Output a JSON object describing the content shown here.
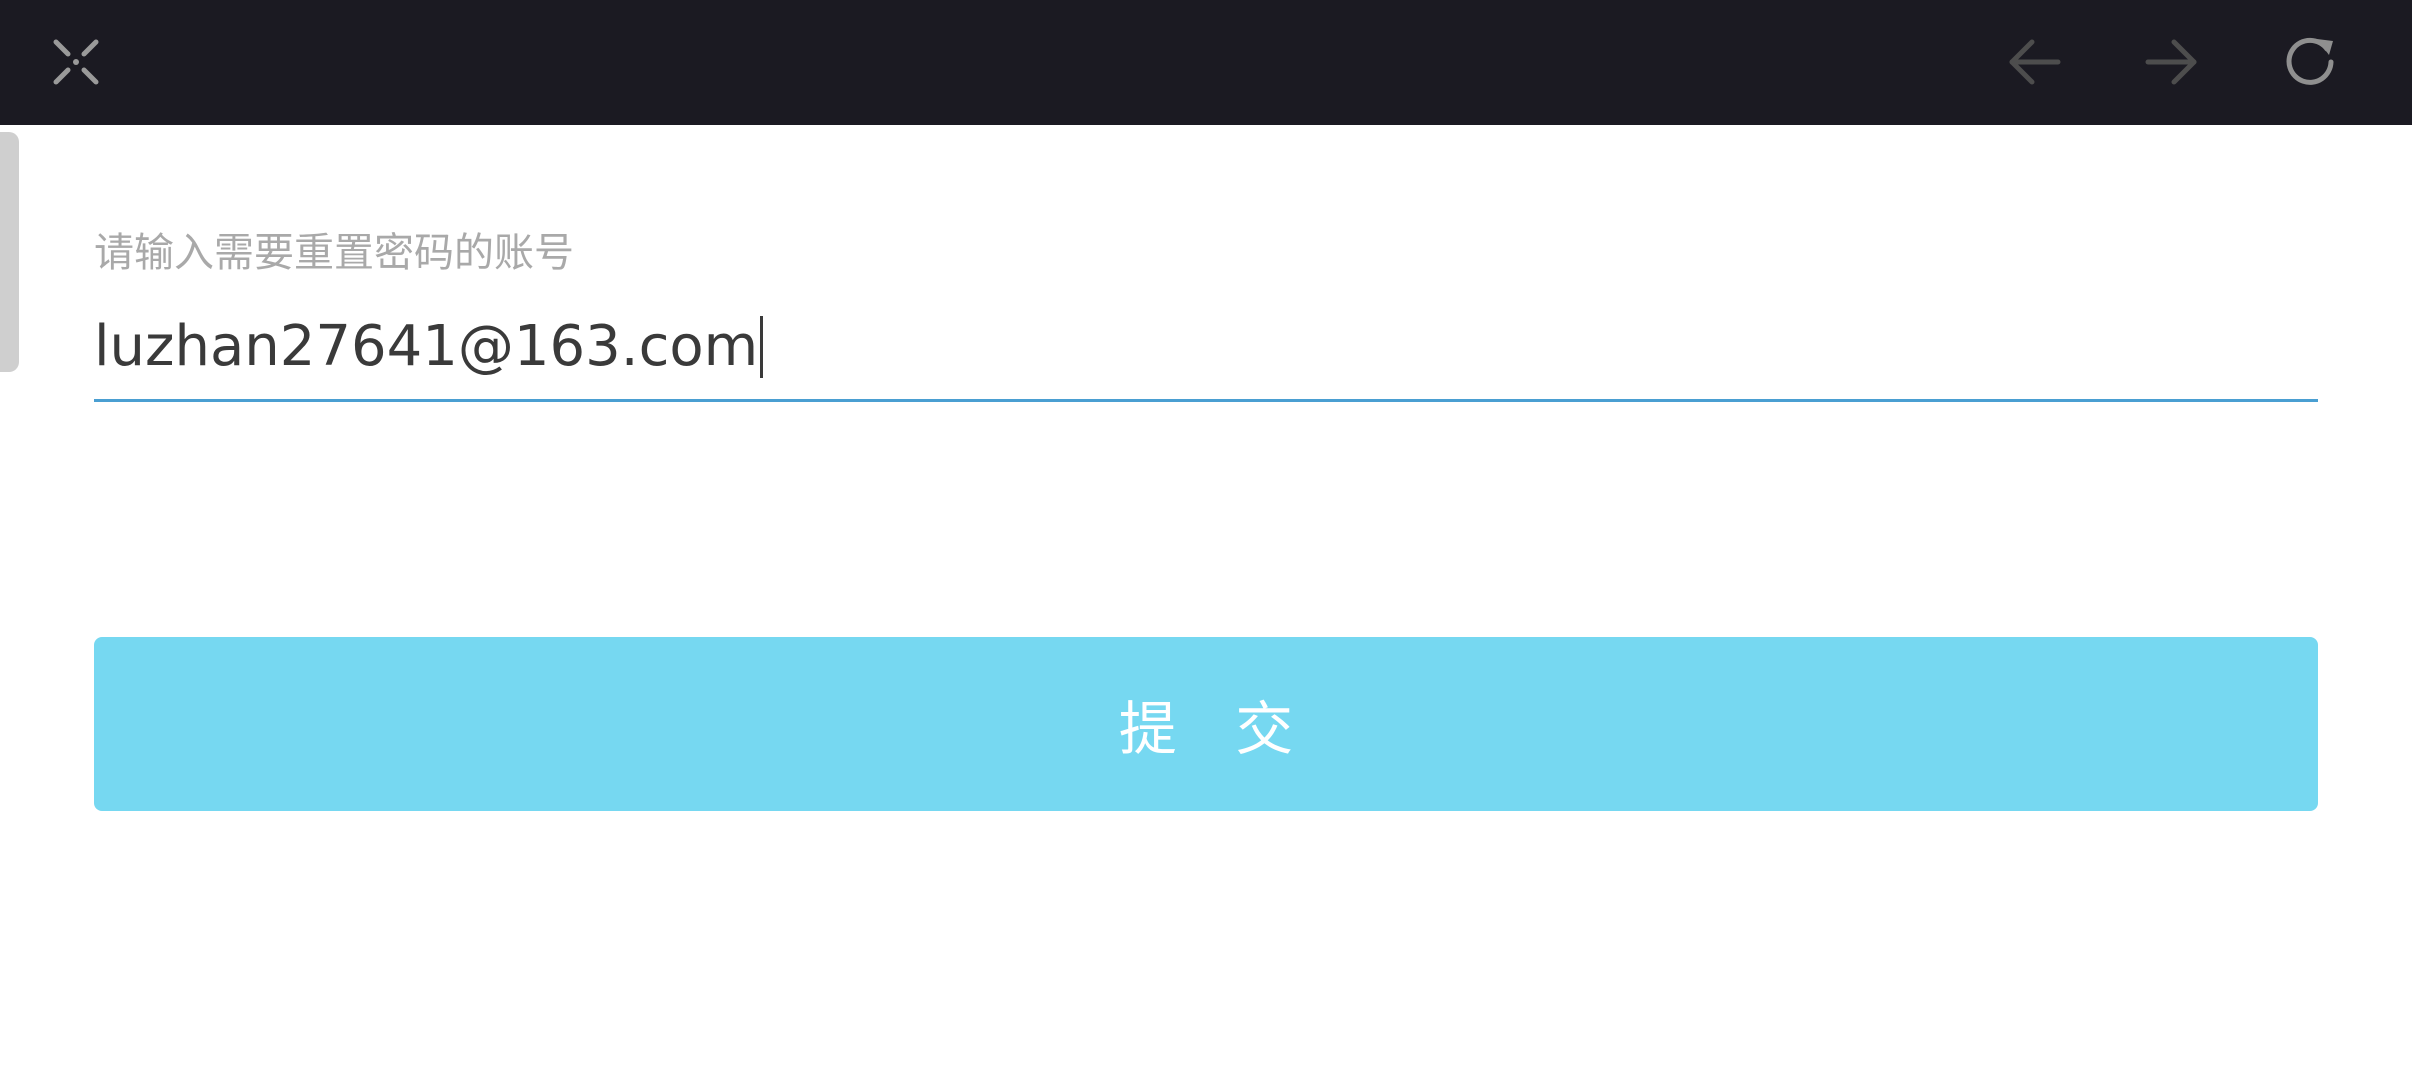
{
  "toolbar": {
    "icons": {
      "close": "close-x-icon",
      "back": "arrow-left-icon",
      "forward": "arrow-right-icon",
      "refresh": "refresh-icon"
    },
    "background_color": "#1b1a22",
    "icon_color": "#8a8a8a",
    "icon_color_disabled": "#555555"
  },
  "form": {
    "account_label": "请输入需要重置密码的账号",
    "account_value": "luzhan27641@163.com",
    "submit_label": "提 交",
    "accent_color": "#4a9fd2",
    "button_color": "#76d8f1"
  }
}
